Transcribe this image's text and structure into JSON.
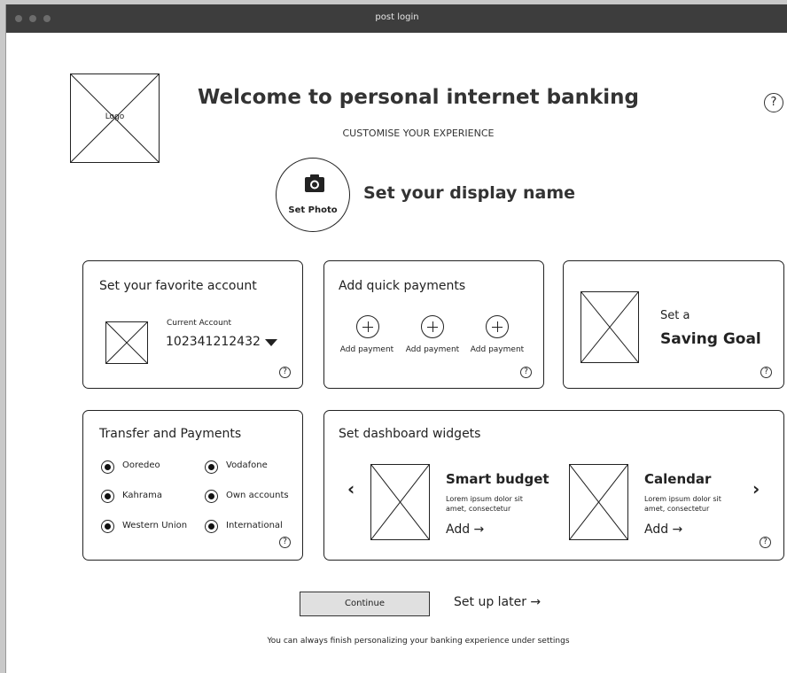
{
  "window": {
    "title": "post login"
  },
  "header": {
    "logo_label": "Logo",
    "title": "Welcome to personal internet banking",
    "subtitle": "CUSTOMISE YOUR EXPERIENCE",
    "help": "?"
  },
  "profile": {
    "photo_icon": "camera-icon",
    "photo_label": "Set Photo",
    "display_name_label": "Set your display name"
  },
  "favorite_account": {
    "title": "Set your favorite account",
    "account_type": "Current Account",
    "account_number": "102341212432",
    "help": "?"
  },
  "quick_payments": {
    "title": "Add quick payments",
    "items": [
      {
        "label": "Add payment"
      },
      {
        "label": "Add payment"
      },
      {
        "label": "Add payment"
      }
    ],
    "help": "?"
  },
  "saving_goal": {
    "line1": "Set a",
    "line2": "Saving Goal",
    "help": "?"
  },
  "transfers": {
    "title": "Transfer and Payments",
    "options": [
      {
        "label": "Ooredeo",
        "selected": true
      },
      {
        "label": "Vodafone",
        "selected": true
      },
      {
        "label": "Kahrama",
        "selected": true
      },
      {
        "label": "Own accounts",
        "selected": true
      },
      {
        "label": "Western Union",
        "selected": true
      },
      {
        "label": "International",
        "selected": true
      }
    ],
    "help": "?"
  },
  "widgets": {
    "title": "Set dashboard widgets",
    "prev": "‹",
    "next": "›",
    "items": [
      {
        "title": "Smart budget",
        "desc_line1": "Lorem ipsum dolor sit",
        "desc_line2": "amet, consectetur",
        "action": "Add →"
      },
      {
        "title": "Calendar",
        "desc_line1": "Lorem ipsum dolor sit",
        "desc_line2": "amet, consectetur",
        "action": "Add →"
      }
    ],
    "help": "?"
  },
  "actions": {
    "continue": "Continue",
    "later": "Set up later →"
  },
  "footer": {
    "note": "You can always finish personalizing  your banking experience under settings"
  }
}
